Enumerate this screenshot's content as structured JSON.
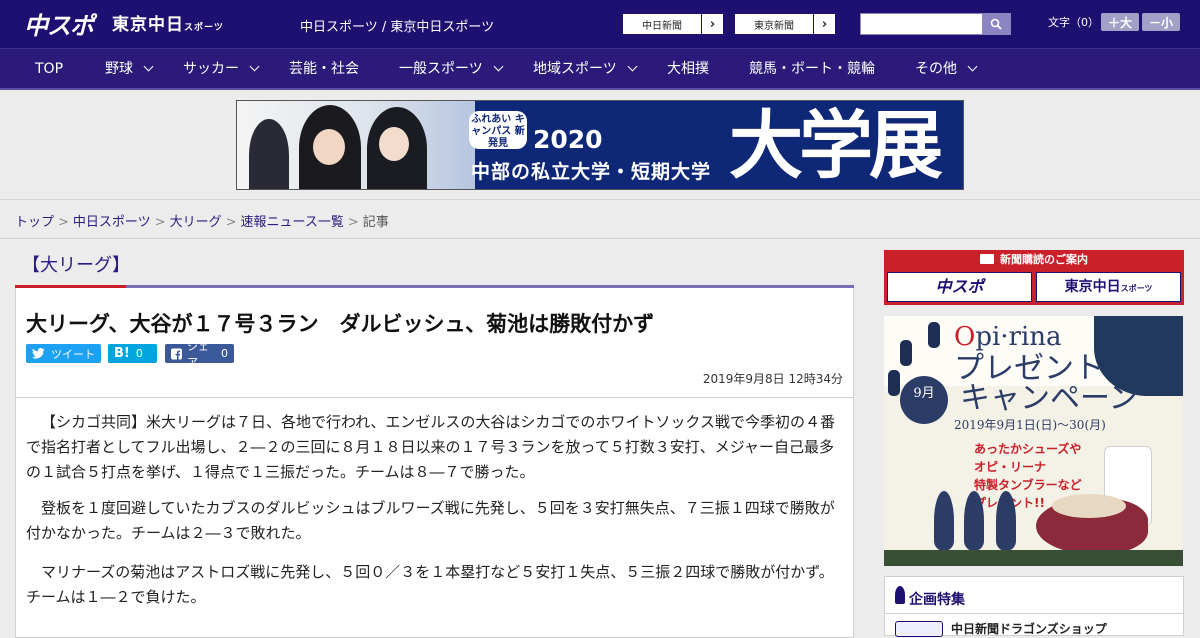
{
  "header": {
    "logo_chuspo": "中スポ",
    "logo_tokyo": "東京中日",
    "logo_tokyo_sub": "スポーツ",
    "site_title": "中日スポーツ / 東京中日スポーツ",
    "links": [
      {
        "label": "中日新聞"
      },
      {
        "label": "東京新聞"
      }
    ],
    "search_placeholder": "",
    "font_size_label": "文字（0）",
    "font_larger": "＋大",
    "font_smaller": "－小"
  },
  "nav": {
    "items": [
      {
        "label": "TOP",
        "has_menu": false
      },
      {
        "label": "野球",
        "has_menu": true
      },
      {
        "label": "サッカー",
        "has_menu": true
      },
      {
        "label": "芸能・社会",
        "has_menu": false
      },
      {
        "label": "一般スポーツ",
        "has_menu": true
      },
      {
        "label": "地域スポーツ",
        "has_menu": true
      },
      {
        "label": "大相撲",
        "has_menu": false
      },
      {
        "label": "競馬・ボート・競輪",
        "has_menu": false
      },
      {
        "label": "その他",
        "has_menu": true
      }
    ]
  },
  "banner": {
    "badge": "ふれあい キャンパス 新発見",
    "year": "2020",
    "subtitle": "中部の私立大学・短期大学",
    "main": "大学展"
  },
  "breadcrumb": {
    "items": [
      "トップ",
      "中日スポーツ",
      "大リーグ",
      "速報ニュース一覧"
    ],
    "current": "記事"
  },
  "article": {
    "section": "【大リーグ】",
    "title": "大リーグ、大谷が１７号３ラン　ダルビッシュ、菊池は勝敗付かず",
    "share": {
      "tweet": "ツイート",
      "hatena": "B!",
      "hatena_count": "0",
      "facebook": "シェア",
      "facebook_count": "0"
    },
    "date": "2019年9月8日 12時34分",
    "paragraphs": [
      "【シカゴ共同】米大リーグは７日、各地で行われ、エンゼルスの大谷はシカゴでのホワイトソックス戦で今季初の４番で指名打者としてフル出場し、２―２の三回に８月１８日以来の１７号３ランを放って５打数３安打、メジャー自己最多の１試合５打点を挙げ、１得点で１三振だった。チームは８―７で勝った。",
      "登板を１度回避していたカブスのダルビッシュはブルワーズ戦に先発し、５回を３安打無失点、７三振１四球で勝敗が付かなかった。チームは２―３で敗れた。",
      "マリナーズの菊池はアストロズ戦に先発し、５回０／３を１本塁打など５安打１失点、５三振２四球で勝敗が付かず。チームは１―２で負けた。"
    ]
  },
  "sidebar": {
    "subscribe": {
      "heading": "新聞購読のご案内",
      "chuspo": "中スポ",
      "tokyo": "東京中日",
      "tokyo_sub": "スポーツ"
    },
    "ad": {
      "brand_prefix": "O",
      "brand": "pi·rina",
      "heading_line1": "プレゼント",
      "heading_line2": "キャンペーン",
      "month": "9月",
      "period": "2019年9月1日(日)〜30(月)",
      "desc": "あったかシューズや\nオピ・リーナ\n特製タンブラーなど\nプレゼント!!"
    },
    "feature": {
      "title": "企画特集",
      "item": "中日新聞ドラゴンズショップ"
    }
  },
  "colors": {
    "header_bg": "#1e1070",
    "nav_bg": "#2c1a7a",
    "accent_red": "#c9202a",
    "twitter": "#1da1f2",
    "hatena": "#00a4de",
    "facebook": "#3b5998"
  }
}
